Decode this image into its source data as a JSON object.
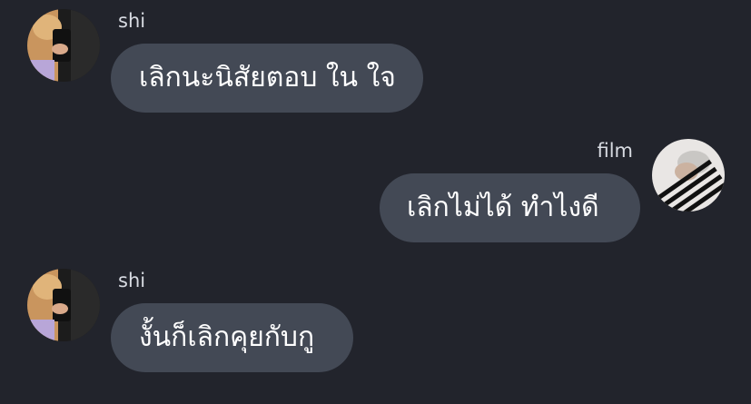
{
  "messages": [
    {
      "sender": "shi",
      "text": "เลิกนะนิสัยตอบ ใน ใจ"
    },
    {
      "sender": "film",
      "text": "เลิกไม่ได้ ทำไงดี"
    },
    {
      "sender": "shi",
      "text": "งั้นก็เลิกคุยกับกู"
    }
  ]
}
